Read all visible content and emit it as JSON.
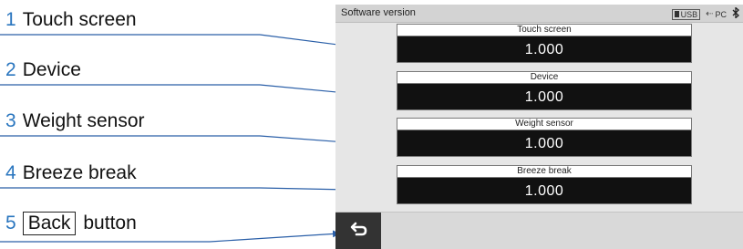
{
  "callouts": [
    {
      "num": "1",
      "label": "Touch screen"
    },
    {
      "num": "2",
      "label": "Device"
    },
    {
      "num": "3",
      "label": "Weight sensor"
    },
    {
      "num": "4",
      "label": "Breeze break"
    },
    {
      "num": "5",
      "boxed": "Back",
      "label": "button"
    }
  ],
  "screen": {
    "title": "Software version",
    "status": {
      "usb": "USB",
      "pc": "PC",
      "bluetooth_icon": "bluetooth-icon"
    },
    "versions": [
      {
        "label": "Touch screen",
        "value": "1.000"
      },
      {
        "label": "Device",
        "value": "1.000"
      },
      {
        "label": "Weight sensor",
        "value": "1.000"
      },
      {
        "label": "Breeze break",
        "value": "1.000"
      }
    ],
    "back_icon": "back-arrow-icon"
  },
  "colors": {
    "callout_number": "#2a76bf",
    "leader_line": "#2a5fa8",
    "value_background": "#111111"
  }
}
